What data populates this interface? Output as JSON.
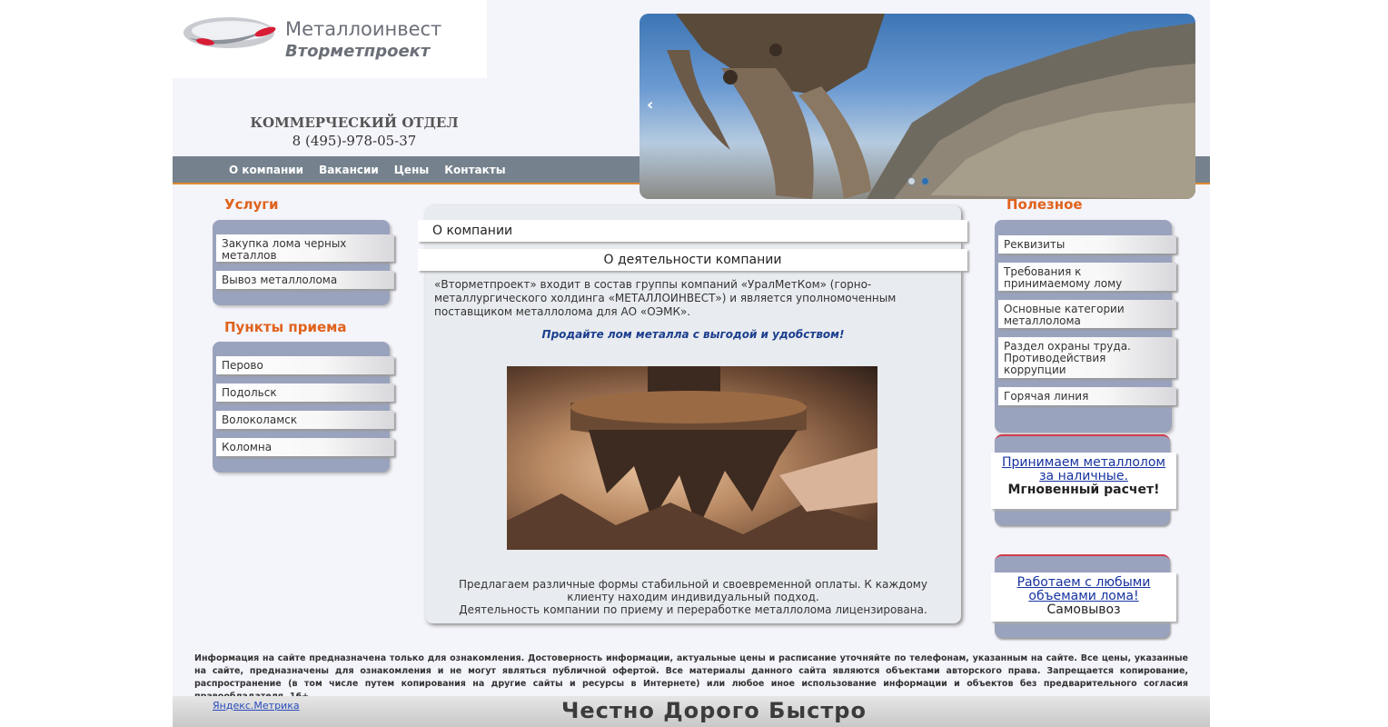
{
  "logo": {
    "line1": "Металлоинвест",
    "line2": "Вторметпроект"
  },
  "header": {
    "dept": "КОММЕРЧЕСКИЙ ОТДЕЛ",
    "phone": "8 (495)-978-05-37"
  },
  "nav": {
    "items": [
      "О компании",
      "Вакансии",
      "Цены",
      "Контакты"
    ]
  },
  "banner": {
    "prev_arrow": "‹",
    "slides": 2,
    "active_slide": 2
  },
  "services": {
    "title": "Услуги",
    "items": [
      "Закупка лома черных металлов",
      "Вывоз металлолома"
    ]
  },
  "points": {
    "title": "Пункты приема",
    "items": [
      "Перово",
      "Подольск",
      "Волоколамск",
      "Коломна"
    ]
  },
  "center": {
    "section": "О компании",
    "heading": "О деятельности компании",
    "intro": "«Вторметпроект» входит в состав группы компаний «УралМетКом» (горно-металлургического холдинга «МЕТАЛЛОИНВЕСТ»)  и является уполномоченным поставщиком металлолома для АО «ОЭМК».",
    "slogan": "Продайте лом металла с выгодой и удобством!",
    "bottom1": "Предлагаем различные формы стабильной и своевременной оплаты. К каждому клиенту находим индивидуальный подход.",
    "bottom2": "Деятельность компании по приему и переработке металлолома лицензирована."
  },
  "useful": {
    "title": "Полезное",
    "items": [
      "Реквизиты",
      "Требования к принимаемому лому",
      "Основные категории металлолома",
      "Раздел охраны труда. Противодействия коррупции",
      "Горячая линия"
    ]
  },
  "promo1": {
    "link": "Принимаем металлолом за наличные.",
    "text": "Мгновенный расчет!"
  },
  "promo2": {
    "link": "Работаем с любыми объемами лома!",
    "text": "Самовывоз"
  },
  "footer": {
    "disclaimer": "Информация на сайте предназначена только для ознакомления. Достоверность информации, актуальные цены и расписание уточняйте по телефонам, указанным на сайте. Все цены, указанные на сайте, предназначены для ознакомления и не могут являться публичной офертой. Все материалы данного сайта являются объектами авторского права. Запрещается копирование, распространение (в том числе путем копирования на другие сайты и ресурсы в Интернете) или любое иное использование информации и объектов без предварительного согласия правообладателя. 16+",
    "metrika": "Яндекс.Метрика",
    "motto": "Честно Дорого Быстро"
  },
  "colors": {
    "accent": "#e0621b",
    "nav": "#75818c",
    "menu": "#9aa3bd",
    "link": "#1733a0"
  }
}
